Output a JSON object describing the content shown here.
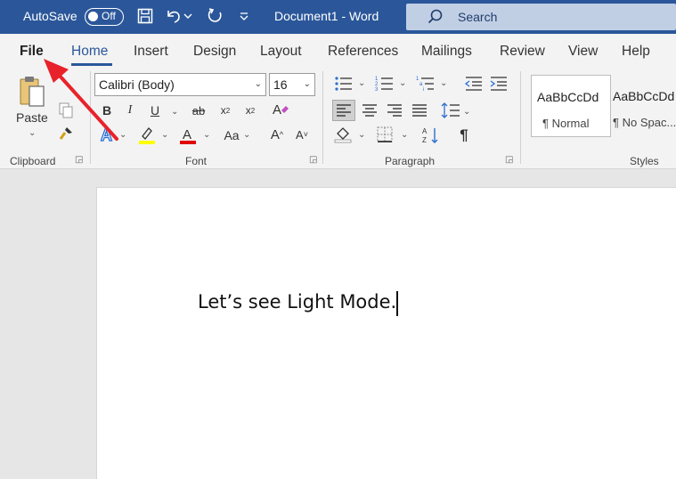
{
  "titlebar": {
    "autosave_label": "AutoSave",
    "autosave_state": "Off",
    "document_title": "Document1  -  Word",
    "search_placeholder": "Search"
  },
  "tabs": [
    {
      "label": "File"
    },
    {
      "label": "Home"
    },
    {
      "label": "Insert"
    },
    {
      "label": "Design"
    },
    {
      "label": "Layout"
    },
    {
      "label": "References"
    },
    {
      "label": "Mailings"
    },
    {
      "label": "Review"
    },
    {
      "label": "View"
    },
    {
      "label": "Help"
    }
  ],
  "active_tab": "Home",
  "ribbon": {
    "clipboard": {
      "label": "Clipboard",
      "paste_label": "Paste"
    },
    "font": {
      "label": "Font",
      "font_name": "Calibri (Body)",
      "font_size": "16",
      "change_case_label": "Aa"
    },
    "paragraph": {
      "label": "Paragraph"
    },
    "styles": {
      "label": "Styles",
      "items": [
        {
          "sample": "AaBbCcDd",
          "name": "¶ Normal"
        },
        {
          "sample": "AaBbCcDd",
          "name": "¶ No Spac..."
        }
      ]
    }
  },
  "document": {
    "text": "Let’s see Light Mode."
  },
  "colors": {
    "titlebar": "#2b579a",
    "accent": "#2b579a",
    "highlight": "#ffff00",
    "font_color": "#e00000",
    "annotation_arrow": "#e8222a"
  }
}
